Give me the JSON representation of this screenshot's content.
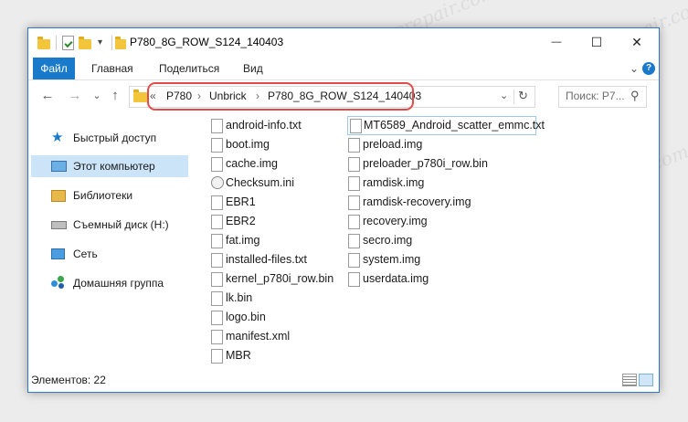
{
  "window": {
    "title": "P780_8G_ROW_S124_140403",
    "buttons": {
      "minimize": "—",
      "maximize": "☐",
      "close": "✕"
    }
  },
  "ribbon": {
    "tabs": [
      "Файл",
      "Главная",
      "Поделиться",
      "Вид"
    ],
    "collapse": "⌄",
    "help": "?"
  },
  "nav": {
    "back": "←",
    "forward": "→",
    "dropdown": "⌄",
    "up": "↑",
    "address": {
      "overflow": "«",
      "crumbs": [
        "P780",
        "Unbrick",
        "P780_8G_ROW_S124_140403"
      ],
      "separator": "›",
      "refresh": "↻"
    },
    "search_placeholder": "Поиск: P7...",
    "search_icon": "⚲"
  },
  "sidebar": {
    "items": [
      {
        "label": "Быстрый доступ",
        "icon": "star-icon"
      },
      {
        "label": "Этот компьютер",
        "icon": "computer-icon",
        "selected": true
      },
      {
        "label": "Библиотеки",
        "icon": "library-icon"
      },
      {
        "label": "Съемный диск (H:)",
        "icon": "removable-drive-icon"
      },
      {
        "label": "Сеть",
        "icon": "network-icon"
      },
      {
        "label": "Домашняя группа",
        "icon": "homegroup-icon"
      }
    ]
  },
  "files": {
    "column1": [
      {
        "name": "android-info.txt",
        "type": "txt"
      },
      {
        "name": "boot.img",
        "type": "img"
      },
      {
        "name": "cache.img",
        "type": "img"
      },
      {
        "name": "Checksum.ini",
        "type": "ini"
      },
      {
        "name": "EBR1",
        "type": "file"
      },
      {
        "name": "EBR2",
        "type": "file"
      },
      {
        "name": "fat.img",
        "type": "img"
      },
      {
        "name": "installed-files.txt",
        "type": "txt"
      },
      {
        "name": "kernel_p780i_row.bin",
        "type": "bin"
      },
      {
        "name": "lk.bin",
        "type": "bin"
      },
      {
        "name": "logo.bin",
        "type": "bin"
      },
      {
        "name": "manifest.xml",
        "type": "xml"
      },
      {
        "name": "MBR",
        "type": "file"
      }
    ],
    "column2": [
      {
        "name": "MT6589_Android_scatter_emmc.txt",
        "type": "txt",
        "focused": true
      },
      {
        "name": "preload.img",
        "type": "img"
      },
      {
        "name": "preloader_p780i_row.bin",
        "type": "bin"
      },
      {
        "name": "ramdisk.img",
        "type": "img"
      },
      {
        "name": "ramdisk-recovery.img",
        "type": "img"
      },
      {
        "name": "recovery.img",
        "type": "img"
      },
      {
        "name": "secro.img",
        "type": "img"
      },
      {
        "name": "system.img",
        "type": "img"
      },
      {
        "name": "userdata.img",
        "type": "img"
      }
    ]
  },
  "status": {
    "count": "Элементов: 22"
  },
  "colors": {
    "accent": "#1979ca",
    "window_border": "#2b7bd6",
    "highlight_ring": "#e34b4b",
    "selected_nav": "#cce4f7"
  },
  "watermark": "Soringpcrepair.com"
}
